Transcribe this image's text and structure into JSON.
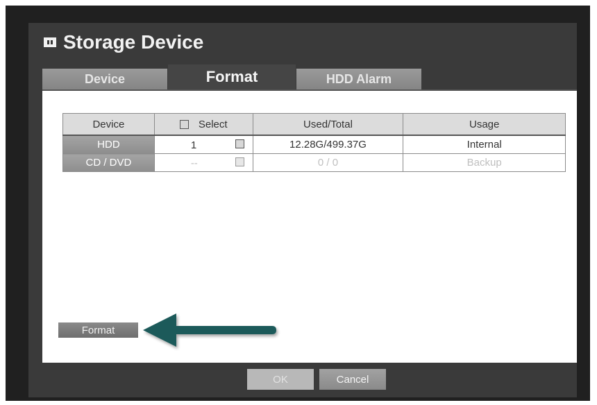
{
  "window": {
    "title": "Storage Device",
    "title_icon": "storage-icon"
  },
  "tabs": [
    {
      "label": "Device",
      "active": false
    },
    {
      "label": "Format",
      "active": true
    },
    {
      "label": "HDD Alarm",
      "active": false
    }
  ],
  "table": {
    "headers": {
      "device": "Device",
      "select": "Select",
      "used_total": "Used/Total",
      "usage": "Usage"
    },
    "rows": [
      {
        "device": "HDD",
        "select_num": "1",
        "used_total": "12.28G/499.37G",
        "usage": "Internal",
        "enabled": true
      },
      {
        "device": "CD / DVD",
        "select_num": "--",
        "used_total": "0 / 0",
        "usage": "Backup",
        "enabled": false
      }
    ]
  },
  "actions": {
    "format_label": "Format"
  },
  "footer": {
    "ok_label": "OK",
    "cancel_label": "Cancel"
  },
  "colors": {
    "arrow": "#1c5a5a",
    "window_bg": "#202020",
    "panel_bg": "#3a3a3a"
  }
}
